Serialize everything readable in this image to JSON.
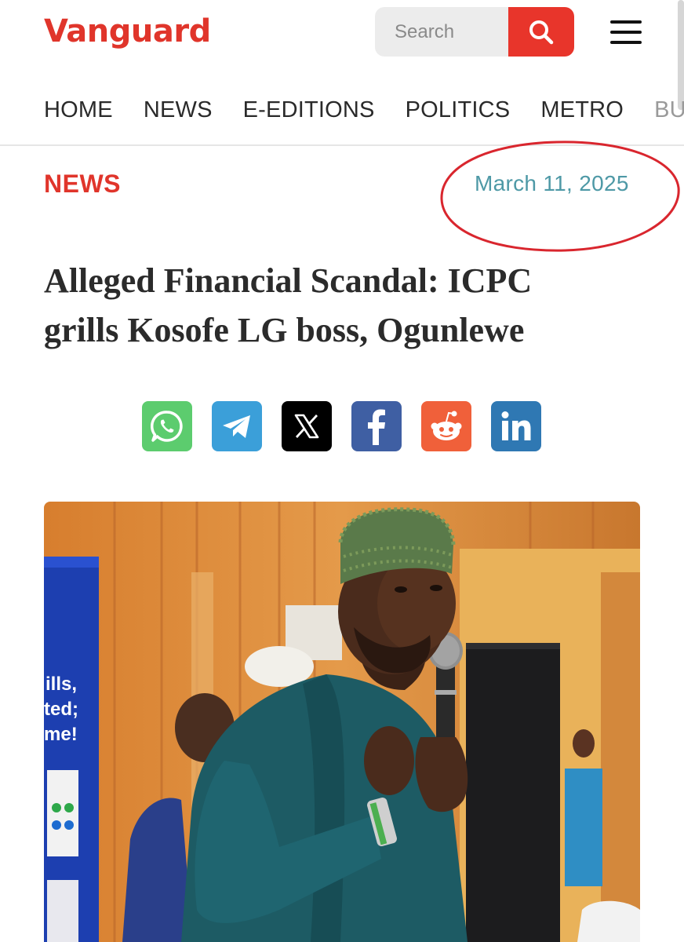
{
  "header": {
    "logo_text": "Vanguard",
    "search_placeholder": "Search"
  },
  "nav": {
    "items": [
      "HOME",
      "NEWS",
      "E-EDITIONS",
      "POLITICS",
      "METRO",
      "BU"
    ]
  },
  "article": {
    "category": "NEWS",
    "date": "March 11, 2025",
    "headline_line1": "Alleged Financial Scandal: ICPC",
    "headline_line2": "grills Kosofe LG boss, Ogunlewe"
  },
  "share": [
    "whatsapp",
    "telegram",
    "x",
    "facebook",
    "reddit",
    "linkedin"
  ],
  "photo": {
    "poster_text_1": "ills,",
    "poster_text_2": "ted;",
    "poster_text_3": "me!"
  },
  "colors": {
    "brand_red": "#e0352b",
    "date_teal": "#4e99a6",
    "annotation_red": "#d9262e",
    "whatsapp": "#5ccc6e",
    "telegram": "#3b9fd9",
    "x": "#000000",
    "facebook": "#3f5fa3",
    "reddit": "#f0603a",
    "linkedin": "#2f78b3"
  }
}
